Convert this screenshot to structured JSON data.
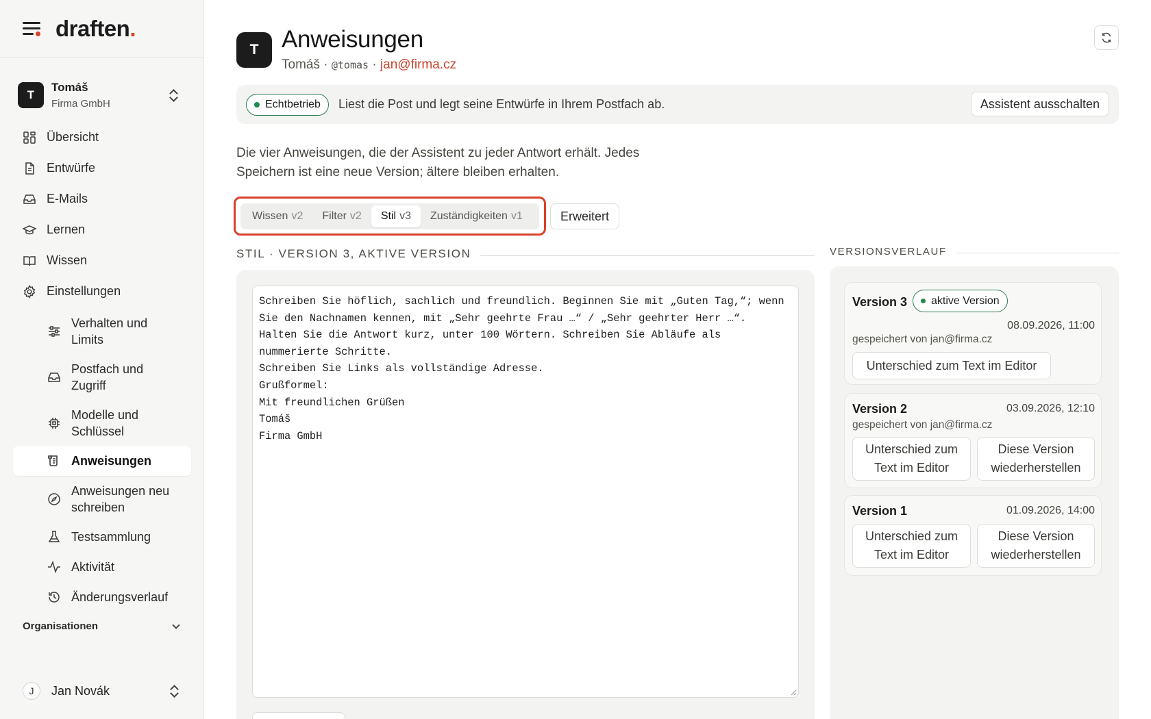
{
  "brand": {
    "logo_text": "draften",
    "logo_dot": ".",
    "accent": "#d9412b"
  },
  "account": {
    "initial": "T",
    "name": "Tomáš",
    "company": "Firma GmbH"
  },
  "nav": {
    "overview": "Übersicht",
    "drafts": "Entwürfe",
    "emails": "E-Mails",
    "learn": "Lernen",
    "knowledge": "Wissen",
    "settings": "Einstellungen",
    "sub": {
      "behavior": "Verhalten und Limits",
      "mailbox": "Postfach und Zugriff",
      "models": "Modelle und Schlüssel",
      "instructions": "Anweisungen",
      "rewrite": "Anweisungen neu schreiben",
      "tests": "Testsammlung",
      "activity": "Aktivität",
      "changes": "Änderungsverlauf"
    },
    "organizations": "Organisationen"
  },
  "user": {
    "initial": "J",
    "name": "Jan Novák"
  },
  "header": {
    "initial": "T",
    "title": "Anweisungen",
    "name": "Tomáš",
    "sep": "·",
    "handle": "@tomas",
    "email": "jan@firma.cz"
  },
  "status": {
    "badge": "Echtbetrieb",
    "text": "Liest die Post und legt seine Entwürfe in Ihrem Postfach ab.",
    "button": "Assistent ausschalten",
    "badge_color": "#1f8a4c"
  },
  "description": "Die vier Anweisungen, die der Assistent zu jeder Antwort erhält. Jedes Speichern ist eine neue Version; ältere bleiben erhalten.",
  "tabs": [
    {
      "label": "Wissen",
      "version": "v2"
    },
    {
      "label": "Filter",
      "version": "v2"
    },
    {
      "label": "Stil",
      "version": "v3"
    },
    {
      "label": "Zuständigkeiten",
      "version": "v1"
    }
  ],
  "advanced_button": "Erweitert",
  "editor": {
    "heading": "STIL · VERSION 3, AKTIVE VERSION",
    "content": "Schreiben Sie höflich, sachlich und freundlich. Beginnen Sie mit „Guten Tag,“; wenn Sie den Nachnamen kennen, mit „Sehr geehrte Frau …“ / „Sehr geehrter Herr …“.\nHalten Sie die Antwort kurz, unter 100 Wörtern. Schreiben Sie Abläufe als nummerierte Schritte.\nSchreiben Sie Links als vollständige Adresse.\nGrußformel:\nMit freundlichen Grüßen\nTomáš\nFirma GmbH"
  },
  "history": {
    "heading": "VERSIONSVERLAUF",
    "versions": [
      {
        "title": "Version 3",
        "badge": "aktive Version",
        "date": "08.09.2026, 11:00",
        "saved_by": "gespeichert von jan@firma.cz",
        "diff": "Unterschied zum Text im Editor"
      },
      {
        "title": "Version 2",
        "date": "03.09.2026, 12:10",
        "saved_by": "gespeichert von jan@firma.cz",
        "diff": "Unterschied zum Text im Editor",
        "restore": "Diese Version wiederherstellen"
      },
      {
        "title": "Version 1",
        "date": "01.09.2026, 14:00",
        "diff": "Unterschied zum Text im Editor",
        "restore": "Diese Version wiederherstellen"
      }
    ]
  }
}
